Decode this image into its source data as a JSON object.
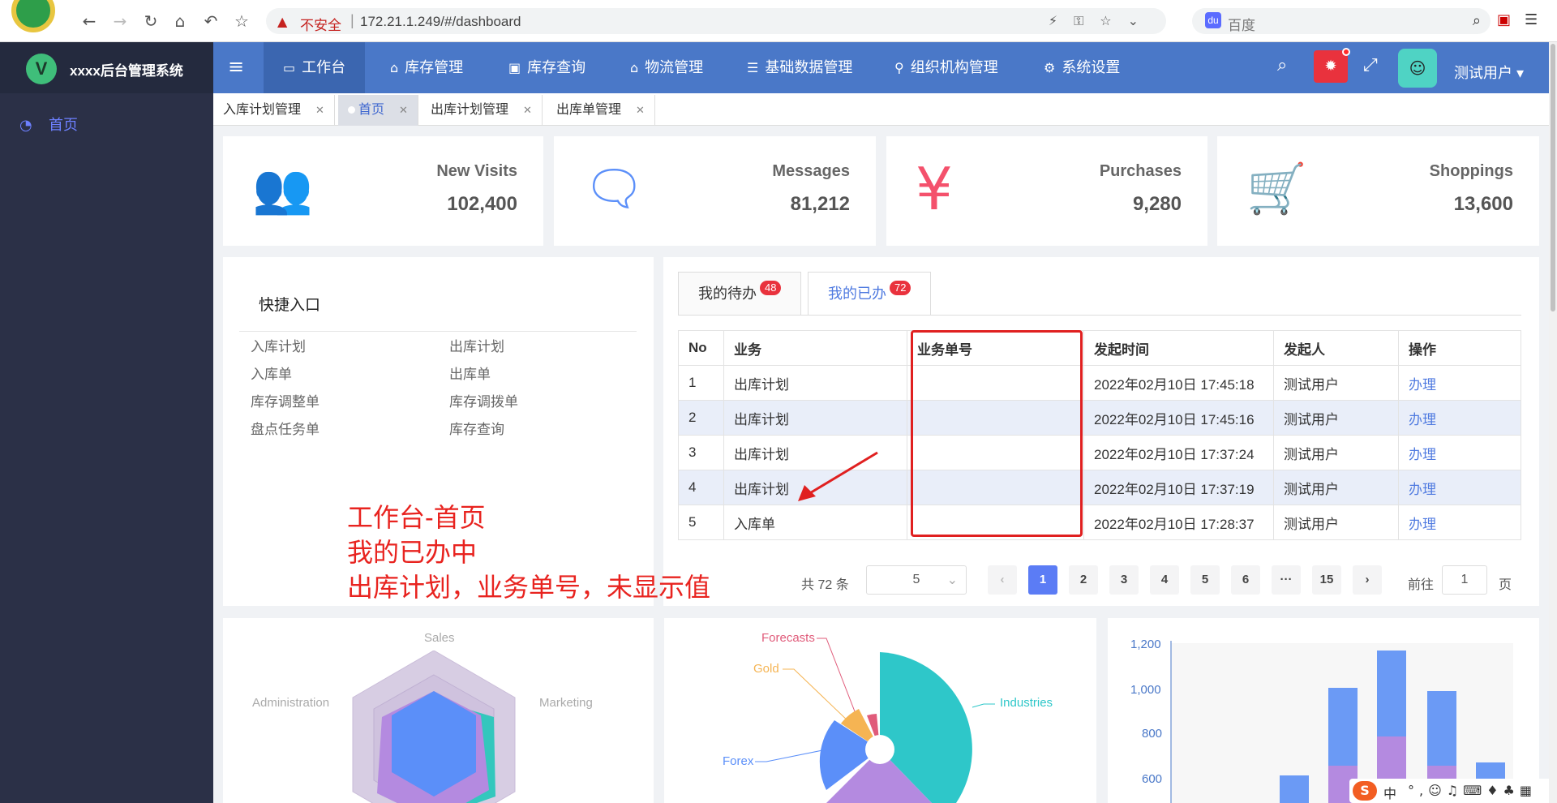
{
  "browser": {
    "insecure_label": "不安全",
    "url": "172.21.1.249/#/dashboard",
    "search_placeholder": "百度",
    "search_badge": "du"
  },
  "app": {
    "logo_letter": "V",
    "brand_name": "xxxx后台管理系统"
  },
  "sidebar": {
    "items": [
      {
        "label": "首页",
        "icon": "dashboard-icon"
      }
    ]
  },
  "topnav": {
    "items": [
      {
        "label": "工作台",
        "icon": "monitor-icon"
      },
      {
        "label": "库存管理",
        "icon": "home-icon"
      },
      {
        "label": "库存查询",
        "icon": "screen-icon"
      },
      {
        "label": "物流管理",
        "icon": "house-icon"
      },
      {
        "label": "基础数据管理",
        "icon": "list-icon"
      },
      {
        "label": "组织机构管理",
        "icon": "org-icon"
      },
      {
        "label": "系统设置",
        "icon": "gear-icon"
      }
    ],
    "user": "测试用户"
  },
  "tabs": [
    {
      "label": "入库计划管理"
    },
    {
      "label": "首页"
    },
    {
      "label": "出库计划管理"
    },
    {
      "label": "出库单管理"
    }
  ],
  "stats": [
    {
      "label": "New Visits",
      "value": "102,400",
      "icon": "users-icon",
      "color": "#40c9c6"
    },
    {
      "label": "Messages",
      "value": "81,212",
      "icon": "message-icon",
      "color": "#5b8ff9"
    },
    {
      "label": "Purchases",
      "value": "9,280",
      "icon": "yen-icon",
      "color": "#f4516c"
    },
    {
      "label": "Shoppings",
      "value": "13,600",
      "icon": "cart-icon",
      "color": "#34bfa3"
    }
  ],
  "quick": {
    "title": "快捷入口",
    "links": [
      "入库计划",
      "出库计划",
      "入库单",
      "出库单",
      "库存调整单",
      "库存调拨单",
      "盘点任务单",
      "库存查询"
    ]
  },
  "todo": {
    "tab_pending": "我的待办",
    "pending_count": "48",
    "tab_done": "我的已办",
    "done_count": "72",
    "columns": [
      "No",
      "业务",
      "业务单号",
      "发起时间",
      "发起人",
      "操作"
    ],
    "rows": [
      {
        "no": "1",
        "biz": "出库计划",
        "code": "",
        "time": "2022年02月10日 17:45:18",
        "user": "测试用户",
        "action": "办理"
      },
      {
        "no": "2",
        "biz": "出库计划",
        "code": "",
        "time": "2022年02月10日 17:45:16",
        "user": "测试用户",
        "action": "办理"
      },
      {
        "no": "3",
        "biz": "出库计划",
        "code": "",
        "time": "2022年02月10日 17:37:24",
        "user": "测试用户",
        "action": "办理"
      },
      {
        "no": "4",
        "biz": "出库计划",
        "code": "",
        "time": "2022年02月10日 17:37:19",
        "user": "测试用户",
        "action": "办理"
      },
      {
        "no": "5",
        "biz": "入库单",
        "code": "",
        "time": "2022年02月10日 17:28:37",
        "user": "测试用户",
        "action": "办理"
      }
    ],
    "pager": {
      "total": "共 72 条",
      "page_size": "5",
      "pages": [
        "1",
        "2",
        "3",
        "4",
        "5",
        "6",
        "···",
        "15"
      ],
      "current": "1",
      "goto_label": "前往",
      "goto_value": "1",
      "page_word": "页"
    }
  },
  "annotation": {
    "lines": [
      "工作台-首页",
      "我的已办中",
      "出库计划，业务单号，未显示值"
    ],
    "color": "#e8231f"
  },
  "radar": {
    "labels": [
      "Sales",
      "Administration",
      "Marketing"
    ]
  },
  "pie": {
    "labels": [
      "Forecasts",
      "Gold",
      "Forex",
      "Industries"
    ],
    "colors": [
      "#e05b7a",
      "#f5b453",
      "#5b8ff9",
      "#2ec7c9"
    ]
  },
  "bars": {
    "y_ticks": [
      "1,200",
      "1,000",
      "800",
      "600"
    ]
  },
  "ime": {
    "lang": "中"
  }
}
